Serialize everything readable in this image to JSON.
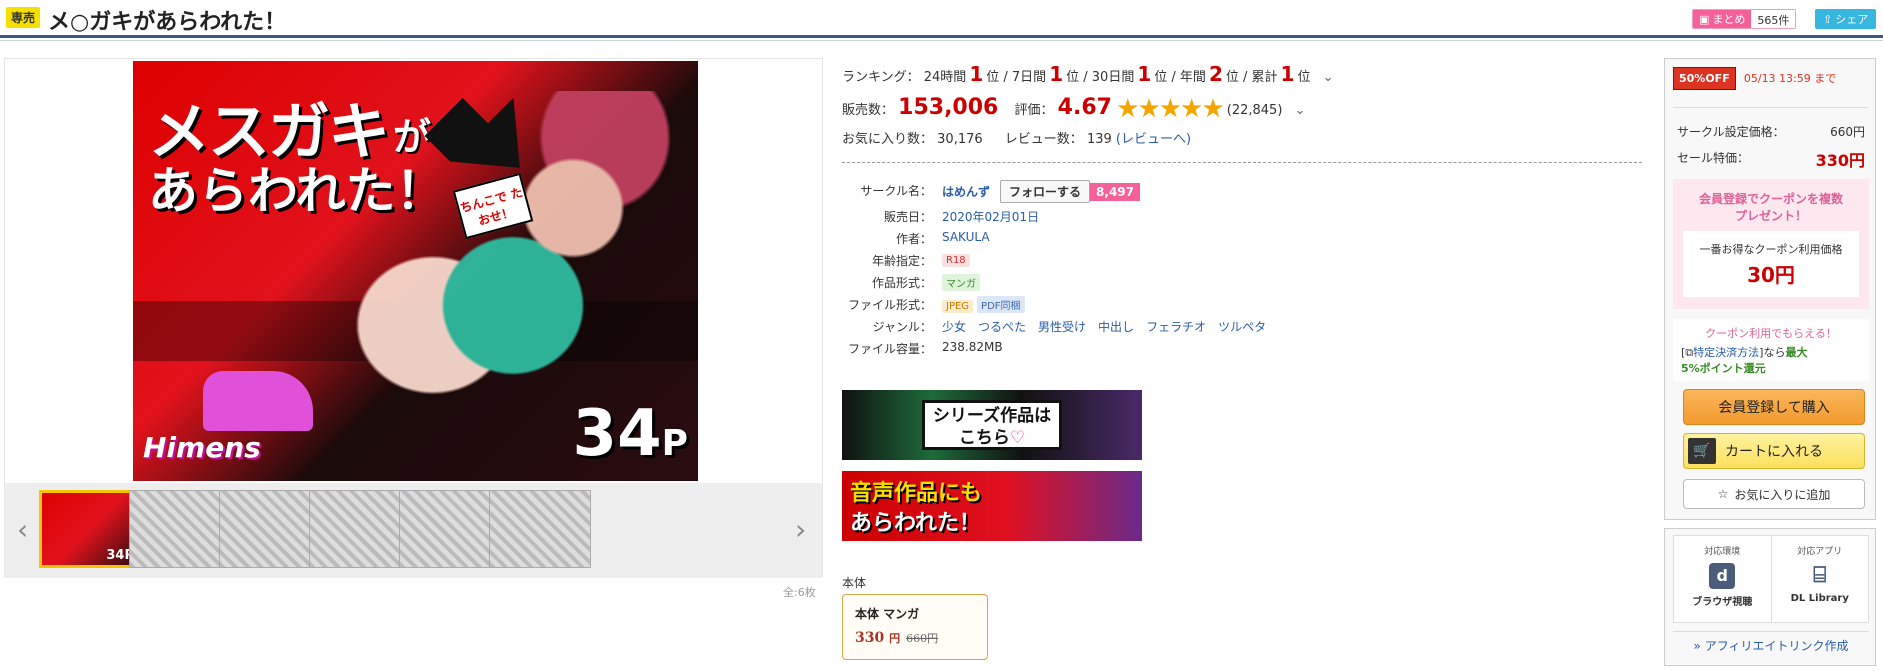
{
  "header": {
    "badge": "専売",
    "title": "メ○ガキがあらわれた！",
    "matome_label": "まとめ",
    "matome_count": "565件",
    "share_label": "シェア"
  },
  "gallery": {
    "cover": {
      "title_line1": "メスガキ",
      "title_ga": "が",
      "title_line2": "あらわれた！",
      "tag": "ちんこで たおせ！",
      "logo": "Himens",
      "pages_num": "34",
      "pages_unit": "P"
    },
    "thumb_count": "全:6枚"
  },
  "ranking": {
    "label": "ランキング：",
    "items": [
      {
        "period": "24時間",
        "rank": "1",
        "unit": "位"
      },
      {
        "period": "7日間",
        "rank": "1",
        "unit": "位"
      },
      {
        "period": "30日間",
        "rank": "1",
        "unit": "位"
      },
      {
        "period": "年間",
        "rank": "2",
        "unit": "位"
      },
      {
        "period": "累計",
        "rank": "1",
        "unit": "位"
      }
    ]
  },
  "sales": {
    "label": "販売数：",
    "value": "153,006",
    "rating_label": "評価：",
    "rating": "4.67",
    "stars": "★★★★★",
    "rating_count": "(22,845)"
  },
  "favs": {
    "label": "お気に入り数：",
    "value": "30,176",
    "review_label": "レビュー数：",
    "review_value": "139",
    "review_link": "(レビューへ)"
  },
  "info": {
    "circle_key": "サークル名：",
    "circle": "はめんず",
    "follow": "フォローする",
    "follow_count": "8,497",
    "release_key": "販売日：",
    "release": "2020年02月01日",
    "author_key": "作者：",
    "author": "SAKULA",
    "age_key": "年齢指定：",
    "age": "R18",
    "format_key": "作品形式：",
    "format": "マンガ",
    "file_key": "ファイル形式：",
    "file1": "JPEG",
    "file2": "PDF同梱",
    "genre_key": "ジャンル：",
    "genres": [
      "少女",
      "つるぺた",
      "男性受け",
      "中出し",
      "フェラチオ",
      "ツルペタ"
    ],
    "size_key": "ファイル容量：",
    "size": "238.82MB"
  },
  "banners": {
    "series_l1": "シリーズ作品は",
    "series_l2": "こちら",
    "series_heart": "♡",
    "voice_l1": "音声作品にも",
    "voice_l2": "あらわれた！"
  },
  "edition": {
    "section_label": "本体",
    "title": "本体 マンガ",
    "price": "330",
    "yen": "円",
    "old_price": "660円"
  },
  "panel": {
    "off": "50%OFF",
    "until": "05/13 13:59 まで",
    "circle_price_label": "サークル設定価格：",
    "circle_price": "660円",
    "sale_label": "セール特価：",
    "sale_price": "330円",
    "coupon_head": "会員登録でクーポンを複数プレゼント！",
    "coupon_sub": "一番お得なクーポン利用価格",
    "coupon_price": "30円",
    "coupon_note": "クーポン利用でもらえる！",
    "note_pre": "[",
    "note_link": "特定決済方法",
    "note_mid": "]なら",
    "note_max": "最大",
    "note_points": "5%ポイント還元",
    "register_btn": "会員登録して購入",
    "cart_btn": "カートに入れる",
    "fav_btn": "お気に入りに追加"
  },
  "env": {
    "col1_label": "対応環境",
    "col1_name": "ブラウザ視聴",
    "col2_label": "対応アプリ",
    "col2_name": "DL Library",
    "affiliate": "» アフィリエイトリンク作成"
  }
}
